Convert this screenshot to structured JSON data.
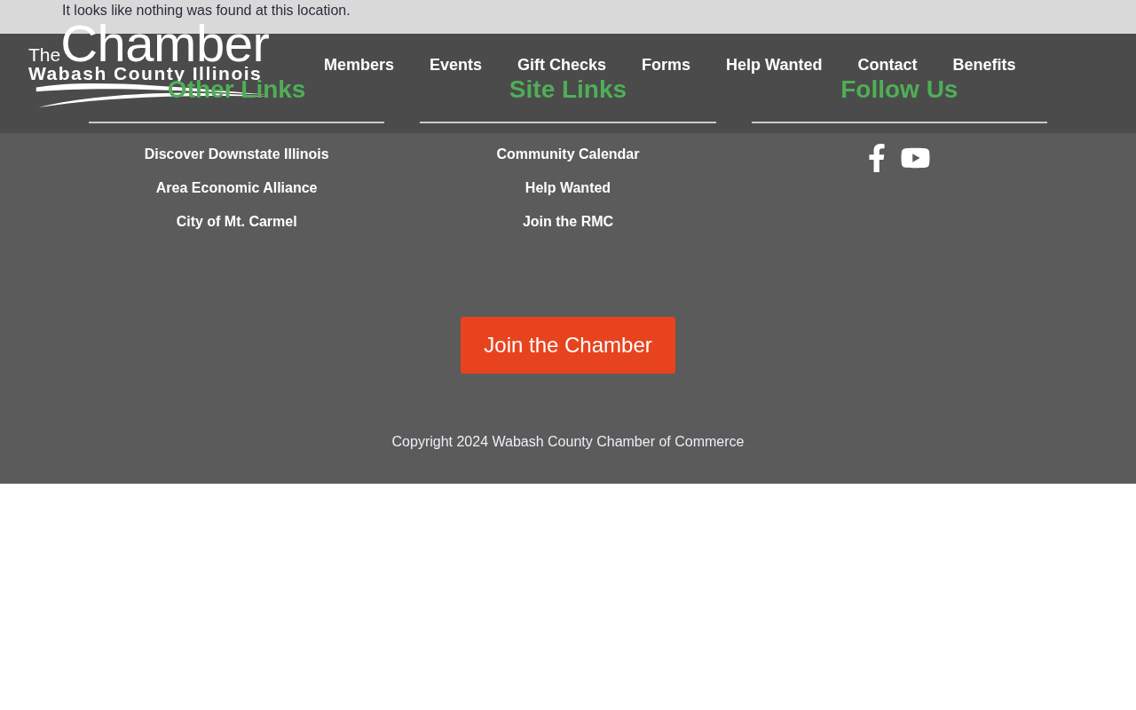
{
  "notice": {
    "text": "It looks like nothing was found at this location."
  },
  "header": {
    "logo": {
      "prefix": "The",
      "name": "Chamber",
      "tagline": "Wabash County Illinois"
    },
    "nav": [
      "Members",
      "Events",
      "Gift Checks",
      "Forms",
      "Help Wanted",
      "Contact",
      "Benefits"
    ]
  },
  "footer": {
    "columns": [
      {
        "heading": "Other Links",
        "links": [
          "Discover Downstate Illinois",
          "Area Economic Alliance",
          "City of Mt. Carmel"
        ]
      },
      {
        "heading": "Site Links",
        "links": [
          "Community Calendar",
          "Help Wanted",
          "Join the RMC"
        ]
      },
      {
        "heading": "Follow Us",
        "social": [
          {
            "kind": "facebook"
          },
          {
            "kind": "youtube"
          }
        ]
      }
    ],
    "cta": "Join the Chamber",
    "copyright": "Copyright 2024 Wabash County Chamber of Commerce"
  }
}
